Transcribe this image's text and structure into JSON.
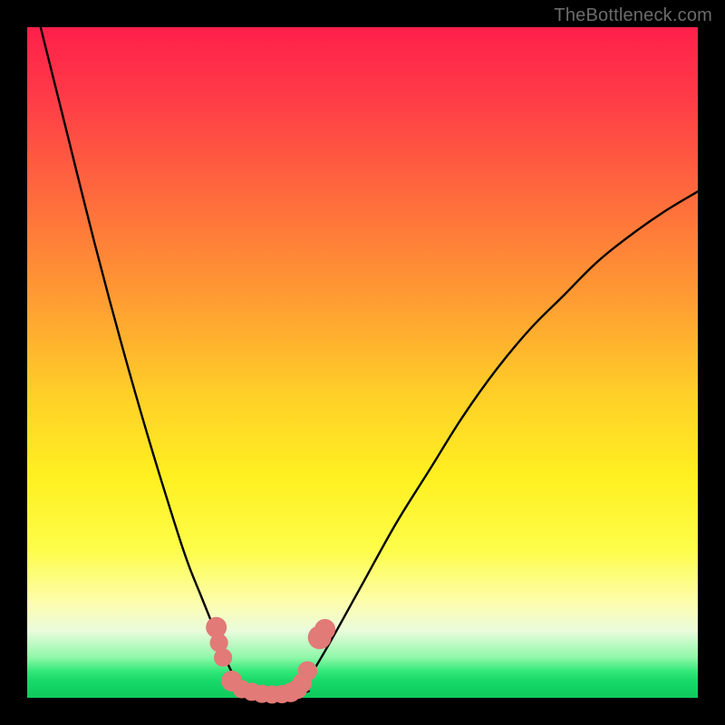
{
  "watermark": "TheBottleneck.com",
  "chart_data": {
    "type": "line",
    "title": "",
    "xlabel": "",
    "ylabel": "",
    "xlim": [
      0,
      100
    ],
    "ylim": [
      0,
      100
    ],
    "series": [
      {
        "name": "left-branch",
        "x": [
          2,
          6,
          10,
          14,
          18,
          22,
          24,
          26,
          28,
          29.5,
          31,
          32.5,
          34
        ],
        "y": [
          100,
          84,
          68,
          53,
          39,
          26,
          20,
          15,
          10,
          6,
          3,
          1.5,
          0.5
        ]
      },
      {
        "name": "right-branch",
        "x": [
          40,
          42,
          45,
          50,
          55,
          60,
          65,
          70,
          75,
          80,
          85,
          90,
          95,
          100
        ],
        "y": [
          0.5,
          3,
          8,
          17,
          26,
          34,
          42,
          49,
          55,
          60,
          65,
          69,
          72.5,
          75.5
        ]
      },
      {
        "name": "valley-floor",
        "x": [
          32,
          34,
          36,
          38,
          40,
          42
        ],
        "y": [
          1,
          0.4,
          0.2,
          0.2,
          0.4,
          1
        ]
      }
    ],
    "markers": {
      "name": "highlight-dots",
      "color": "#e27a77",
      "points": [
        {
          "x": 28.2,
          "y": 10.5,
          "r": 1.6
        },
        {
          "x": 28.6,
          "y": 8.2,
          "r": 1.4
        },
        {
          "x": 29.2,
          "y": 6.0,
          "r": 1.4
        },
        {
          "x": 30.5,
          "y": 2.5,
          "r": 1.6
        },
        {
          "x": 32.0,
          "y": 1.3,
          "r": 1.4
        },
        {
          "x": 33.5,
          "y": 0.9,
          "r": 1.4
        },
        {
          "x": 35.0,
          "y": 0.6,
          "r": 1.4
        },
        {
          "x": 36.5,
          "y": 0.5,
          "r": 1.4
        },
        {
          "x": 38.0,
          "y": 0.55,
          "r": 1.4
        },
        {
          "x": 39.3,
          "y": 0.8,
          "r": 1.5
        },
        {
          "x": 40.3,
          "y": 1.3,
          "r": 1.5
        },
        {
          "x": 41.0,
          "y": 2.2,
          "r": 1.5
        },
        {
          "x": 41.8,
          "y": 4.0,
          "r": 1.5
        },
        {
          "x": 43.6,
          "y": 9.0,
          "r": 1.8
        },
        {
          "x": 44.4,
          "y": 10.2,
          "r": 1.6
        }
      ]
    },
    "background_gradient": {
      "top": "#ff1f4a",
      "upper_mid": "#ffb029",
      "mid": "#fff020",
      "lower_mid": "#fdfdb0",
      "bottom": "#16d968"
    }
  }
}
